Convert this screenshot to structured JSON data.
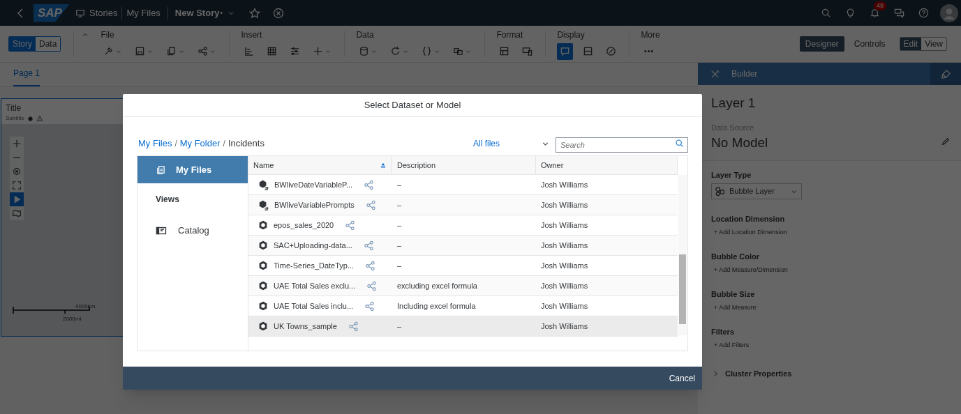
{
  "shell": {
    "logo": "SAP",
    "nav": [
      "Stories",
      "My Files"
    ],
    "story_title": "New Story",
    "unsaved_mark": "•",
    "notification_count": "49"
  },
  "toolbar": {
    "view_toggle": [
      {
        "label": "Story",
        "selected": true
      },
      {
        "label": "Data",
        "selected": false
      }
    ],
    "groups": [
      {
        "label": "File"
      },
      {
        "label": "Insert"
      },
      {
        "label": "Data"
      },
      {
        "label": "Format"
      },
      {
        "label": "Display"
      },
      {
        "label": "More"
      }
    ],
    "display_selected": [
      true,
      false,
      false
    ],
    "modes": [
      {
        "label": "Designer",
        "selected": true
      },
      {
        "label": "Controls",
        "selected": false
      }
    ],
    "edit_view": [
      {
        "label": "Edit",
        "selected": true
      },
      {
        "label": "View",
        "selected": false
      }
    ]
  },
  "page_tabs": [
    {
      "label": "Page 1",
      "selected": true
    }
  ],
  "widget": {
    "title": "Title",
    "subtitle": "Subtitle",
    "scale_km": "4000km",
    "scale_mi": "2000mi"
  },
  "builder": {
    "header": "Builder",
    "layer": "Layer 1",
    "data_source_label": "Data Source",
    "model": "No Model",
    "layer_type": {
      "label": "Layer Type",
      "value": "Bubble Layer"
    },
    "sections": [
      {
        "label": "Location Dimension",
        "action": "+ Add Location Dimension"
      },
      {
        "label": "Bubble Color",
        "action": "+ Add Measure/Dimension"
      },
      {
        "label": "Bubble Size",
        "action": "+ Add Measure"
      },
      {
        "label": "Filters",
        "action": "+ Add Filters"
      }
    ],
    "cluster": {
      "label": "Cluster Properties",
      "expanded": false
    }
  },
  "dialog": {
    "title": "Select Dataset or Model",
    "breadcrumb": [
      {
        "kind": "link",
        "label": "My Files"
      },
      {
        "kind": "separator",
        "label": "/"
      },
      {
        "kind": "link",
        "label": "My Folder"
      },
      {
        "kind": "separator",
        "label": "/"
      },
      {
        "kind": "current",
        "label": "Incidents"
      }
    ],
    "filter": "All files",
    "search": {
      "placeholder": "Search"
    },
    "side_nav": [
      {
        "kind": "item",
        "label": "My Files",
        "selected": true
      },
      {
        "kind": "heading",
        "label": "Views"
      },
      {
        "kind": "item",
        "label": "Catalog",
        "selected": false
      }
    ],
    "columns": [
      "Name",
      "Description",
      "Owner"
    ],
    "rows": [
      {
        "kind": "bw",
        "name": "BWliveDateVariableP...",
        "description": "–",
        "owner": "Josh Williams",
        "selected": false
      },
      {
        "kind": "bw",
        "name": "BWliveVariablePrompts",
        "description": "–",
        "owner": "Josh Williams",
        "selected": false
      },
      {
        "kind": "model",
        "name": "epos_sales_2020",
        "description": "–",
        "owner": "Josh Williams",
        "selected": false
      },
      {
        "kind": "model",
        "name": "SAC+Uploading-data...",
        "description": "–",
        "owner": "Josh Williams",
        "selected": false
      },
      {
        "kind": "model",
        "name": "Time-Series_DateTyp...",
        "description": "–",
        "owner": "Josh Williams",
        "selected": false
      },
      {
        "kind": "model",
        "name": "UAE Total Sales exclu...",
        "description": "excluding excel formula",
        "owner": "Josh Williams",
        "selected": false
      },
      {
        "kind": "model",
        "name": "UAE Total Sales inclu...",
        "description": "Including excel formula",
        "owner": "Josh Williams",
        "selected": false
      },
      {
        "kind": "model",
        "name": "UK Towns_sample",
        "description": "–",
        "owner": "Josh Williams",
        "selected": true
      }
    ],
    "cancel": "Cancel"
  }
}
